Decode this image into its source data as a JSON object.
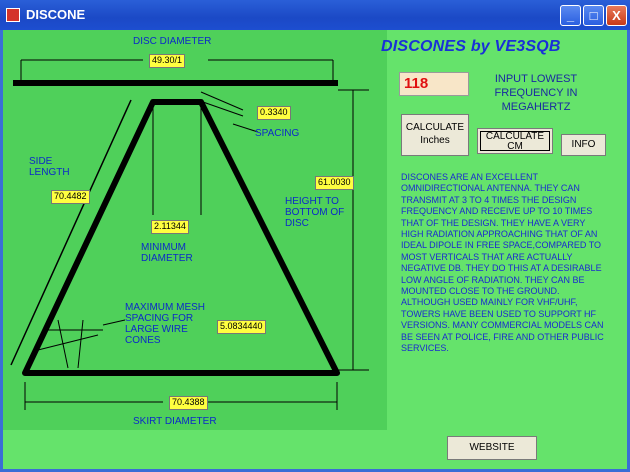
{
  "window": {
    "title": "DISCONE"
  },
  "title_buttons": {
    "minimize": "_",
    "maximize": "□",
    "close": "X"
  },
  "app_title": "DISCONES by VE3SQB",
  "frequency": {
    "value": "118",
    "label": "INPUT LOWEST FREQUENCY IN MEGAHERTZ"
  },
  "buttons": {
    "calc_inches": "CALCULATE Inches",
    "calc_cm": "CALCULATE CM",
    "info": "INFO",
    "website": "WEBSITE"
  },
  "diagram": {
    "disc_diameter_label": "DISC DIAMETER",
    "disc_diameter_value": "49.30/1",
    "spacing_label": "SPACING",
    "spacing_value": "0.3340",
    "side_length_label": "SIDE LENGTH",
    "side_length_value": "70.4482",
    "height_label": "HEIGHT TO BOTTOM OF DISC",
    "height_value": "61.0030",
    "min_diameter_label": "MINIMUM DIAMETER",
    "min_diameter_value": "2.11344",
    "mesh_label": "MAXIMUM MESH SPACING FOR LARGE WIRE CONES",
    "mesh_value": "5.0834440",
    "skirt_label": "SKIRT DIAMETER",
    "skirt_value": "70.4388"
  },
  "description": "DISCONES ARE AN EXCELLENT OMNIDIRECTIONAL ANTENNA. THEY CAN TRANSMIT AT 3 TO 4 TIMES THE DESIGN FREQUENCY AND RECEIVE UP TO 10 TIMES THAT OF THE DESIGN. THEY HAVE A VERY HIGH RADIATION APPROACHING THAT OF AN IDEAL DIPOLE IN FREE SPACE,COMPARED TO MOST VERTICALS THAT ARE ACTUALLY NEGATIVE DB. THEY DO THIS AT A DESIRABLE LOW ANGLE OF RADIATION. THEY CAN BE MOUNTED CLOSE TO THE GROUND. ALTHOUGH USED MAINLY FOR VHF/UHF, TOWERS HAVE BEEN USED TO SUPPORT HF VERSIONS. MANY COMMERCIAL MODELS CAN BE SEEN AT POLICE, FIRE AND OTHER PUBLIC SERVICES."
}
